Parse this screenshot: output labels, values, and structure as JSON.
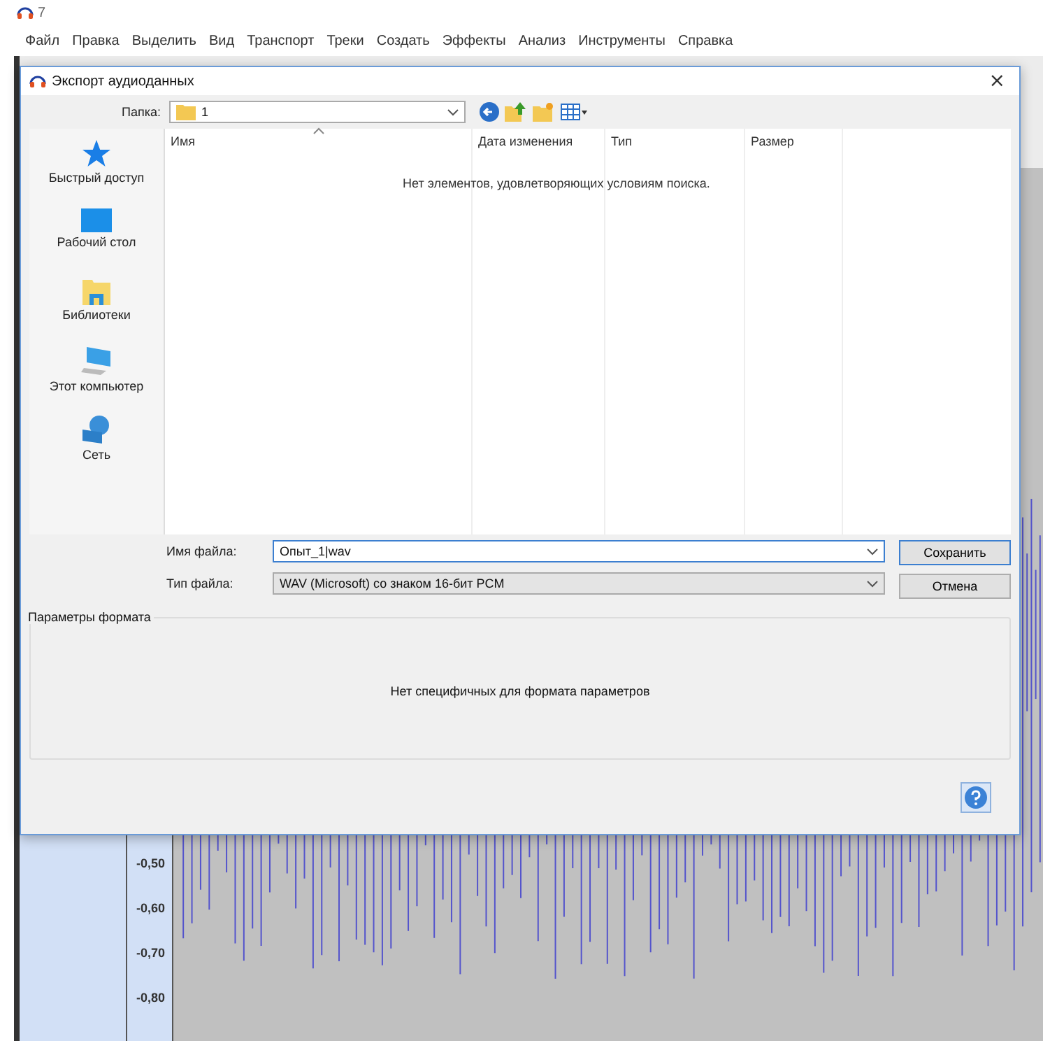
{
  "app": {
    "title": "7",
    "menu": [
      "Файл",
      "Правка",
      "Выделить",
      "Вид",
      "Транспорт",
      "Треки",
      "Создать",
      "Эффекты",
      "Анализ",
      "Инструменты",
      "Справка"
    ],
    "ruler_labels": [
      "-0,50",
      "-0,60",
      "-0,70",
      "-0,80"
    ]
  },
  "dialog": {
    "title": "Экспорт аудиоданных",
    "close": "×",
    "folder_label": "Папка:",
    "folder": "1",
    "places": [
      "Быстрый доступ",
      "Рабочий стол",
      "Библиотеки",
      "Этот компьютер",
      "Сеть"
    ],
    "columns": [
      {
        "label": "Имя",
        "sorted": true
      },
      {
        "label": "Дата изменения",
        "sorted": false
      },
      {
        "label": "Тип",
        "sorted": false
      },
      {
        "label": "Размер",
        "sorted": false
      }
    ],
    "empty_message": "Нет элементов, удовлетворяющих условиям поиска.",
    "filename_label": "Имя файла:",
    "filename": "Опыт_1|wav",
    "filetype_label": "Тип файла:",
    "filetype": "WAV (Microsoft) со знаком 16-бит PCM",
    "buttons": [
      {
        "label": "Сохранить",
        "default": true
      },
      {
        "label": "Отмена",
        "default": false
      }
    ],
    "options_title": "Параметры формата",
    "options_message": "Нет специфичных для формата параметров"
  }
}
